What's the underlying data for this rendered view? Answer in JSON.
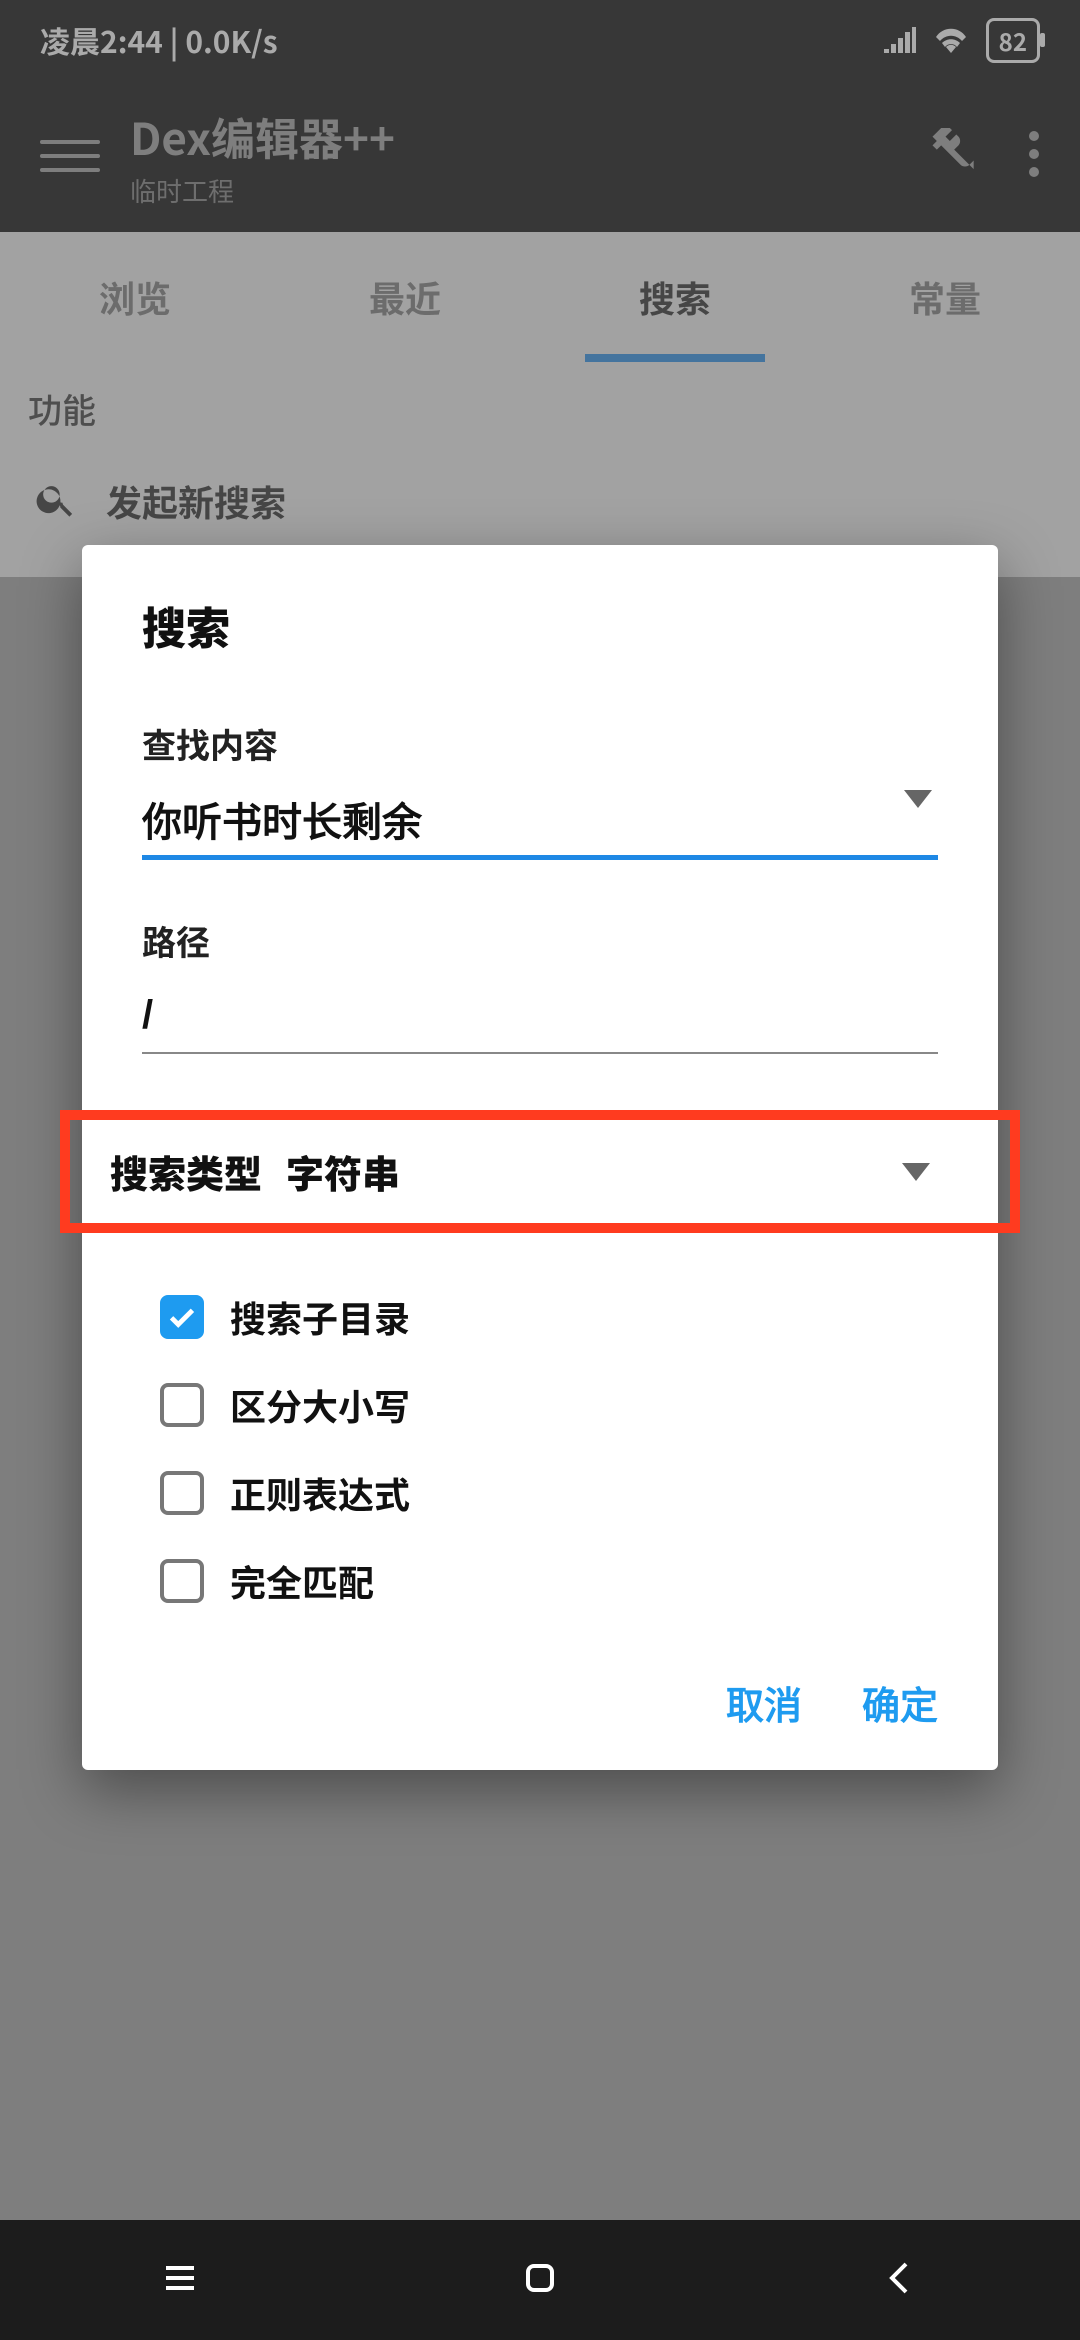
{
  "status": {
    "time": "凌晨2:44 | 0.0K/s",
    "battery": "82"
  },
  "app": {
    "title": "Dex编辑器++",
    "subtitle": "临时工程"
  },
  "tabs": {
    "t0": "浏览",
    "t1": "最近",
    "t2": "搜索",
    "t3": "常量"
  },
  "section": {
    "header": "功能",
    "newSearch": "发起新搜索"
  },
  "dialog": {
    "title": "搜索",
    "findLabel": "查找内容",
    "findValue": "你听书时长剩余",
    "pathLabel": "路径",
    "pathValue": "/",
    "typeLabel": "搜索类型",
    "typeValue": "字符串",
    "checks": {
      "subdir": "搜索子目录",
      "caseSensitive": "区分大小写",
      "regex": "正则表达式",
      "exact": "完全匹配"
    },
    "cancel": "取消",
    "ok": "确定"
  }
}
